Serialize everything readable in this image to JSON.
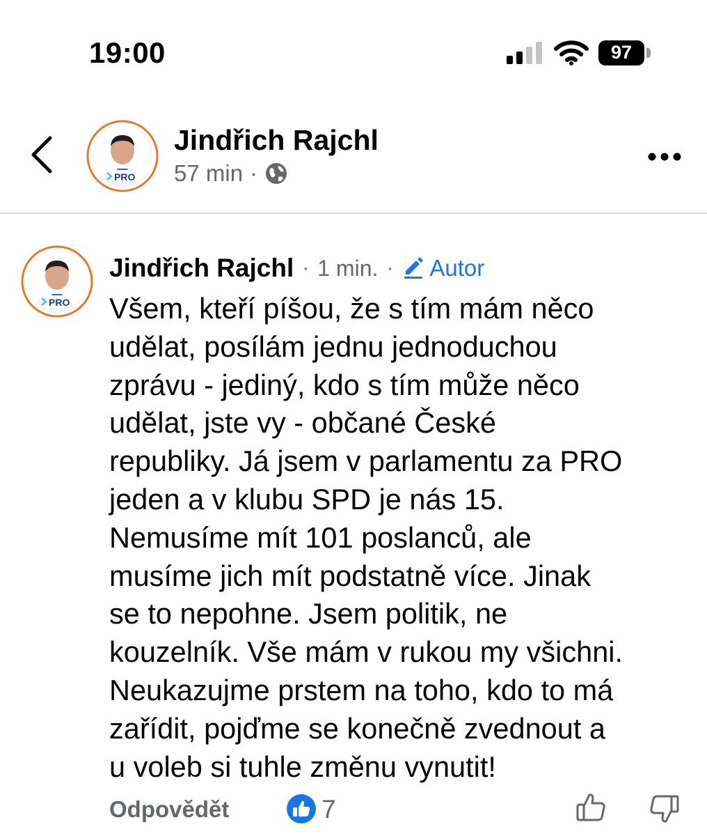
{
  "status_bar": {
    "time": "19:00",
    "battery": "97",
    "icons": [
      "signal-icon",
      "wifi-icon",
      "battery-icon"
    ]
  },
  "header": {
    "author": "Jindřich Rajchl",
    "time": "57 min",
    "separator": "·",
    "icons": [
      "back-chevron-icon",
      "globe-icon",
      "more-dots-icon"
    ],
    "avatar_badge": "PRO"
  },
  "comment": {
    "author": "Jindřich Rajchl",
    "separator": "·",
    "time": "1 min.",
    "separator2": "·",
    "badge": "Autor",
    "avatar_badge": "PRO",
    "text_lines": [
      "Všem, kteří píšou, že s tím mám něco",
      "udělat, posílám jednu jednoduchou",
      "zprávu - jediný, kdo s tím může něco",
      "udělat, jste vy - občané České",
      "republiky. Já jsem v parlamentu za PRO",
      "jeden a v klubu SPD je nás 15.",
      "Nemusíme mít 101 poslanců, ale",
      "musíme jich mít podstatně více. Jinak",
      "se to nepohne. Jsem politik, ne",
      "kouzelník. Vše mám v rukou my všichni.",
      "Neukazujme prstem na toho, kdo to má",
      "zařídit, pojďme se konečně zvednout a",
      "u voleb si tuhle změnu vynutit!"
    ]
  },
  "actions": {
    "reply_label": "Odpovědět",
    "like_count": "7"
  },
  "colors": {
    "accent_blue": "#1b74e4",
    "secondary_text": "#65676b",
    "divider": "#dadde1"
  }
}
